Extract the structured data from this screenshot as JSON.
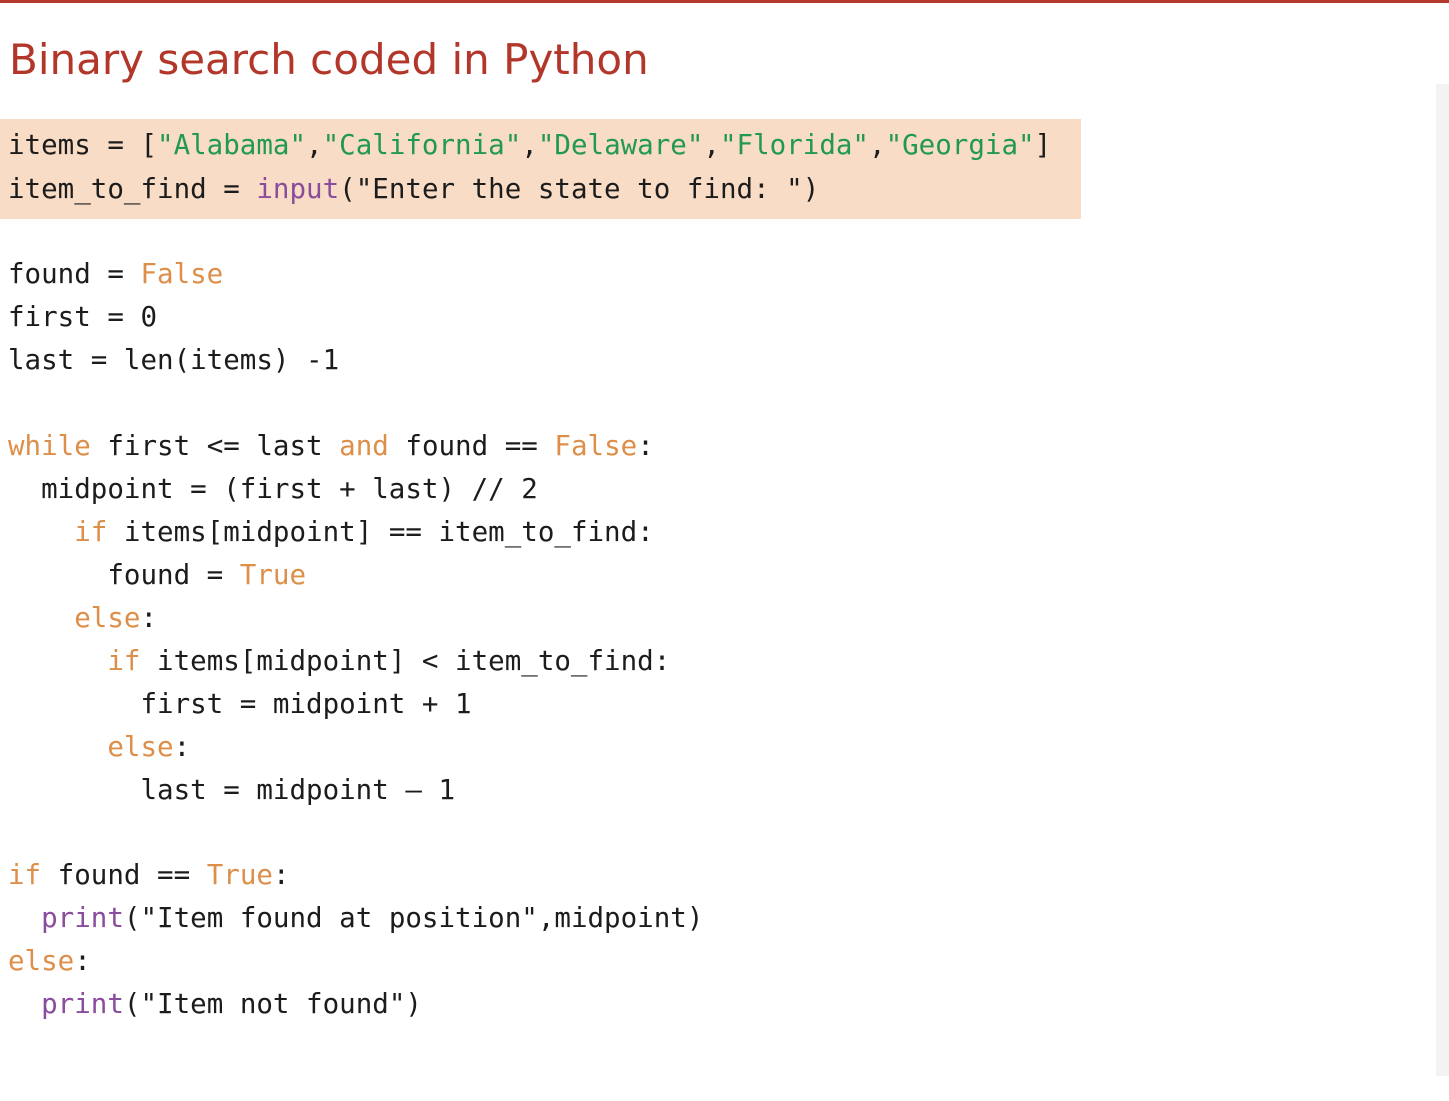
{
  "slide": {
    "title": "Binary search coded in Python"
  },
  "code": {
    "language": "Python",
    "lines": [
      [
        {
          "t": "plain",
          "v": "items = ["
        },
        {
          "t": "str",
          "v": "\"Alabama\""
        },
        {
          "t": "plain",
          "v": ","
        },
        {
          "t": "str",
          "v": "\"California\""
        },
        {
          "t": "plain",
          "v": ","
        },
        {
          "t": "str",
          "v": "\"Delaware\""
        },
        {
          "t": "plain",
          "v": ","
        },
        {
          "t": "str",
          "v": "\"Florida\""
        },
        {
          "t": "plain",
          "v": ","
        },
        {
          "t": "str",
          "v": "\"Georgia\""
        },
        {
          "t": "plain",
          "v": "]"
        }
      ],
      [
        {
          "t": "plain",
          "v": "item_to_find = "
        },
        {
          "t": "fn",
          "v": "input"
        },
        {
          "t": "plain",
          "v": "(\"Enter the state to find: \")"
        }
      ],
      [
        {
          "t": "plain",
          "v": "found = "
        },
        {
          "t": "kw",
          "v": "False"
        }
      ],
      [
        {
          "t": "plain",
          "v": "first = 0"
        }
      ],
      [
        {
          "t": "plain",
          "v": "last = len(items) -1"
        }
      ],
      [
        {
          "t": "kw",
          "v": "while"
        },
        {
          "t": "plain",
          "v": " first <= last "
        },
        {
          "t": "kw",
          "v": "and"
        },
        {
          "t": "plain",
          "v": " found == "
        },
        {
          "t": "kw",
          "v": "False"
        },
        {
          "t": "plain",
          "v": ":"
        }
      ],
      [
        {
          "t": "plain",
          "v": "  midpoint = (first + last) // 2"
        }
      ],
      [
        {
          "t": "plain",
          "v": "    "
        },
        {
          "t": "kw",
          "v": "if"
        },
        {
          "t": "plain",
          "v": " items[midpoint] == item_to_find:"
        }
      ],
      [
        {
          "t": "plain",
          "v": "      found = "
        },
        {
          "t": "kw",
          "v": "True"
        }
      ],
      [
        {
          "t": "plain",
          "v": "    "
        },
        {
          "t": "kw",
          "v": "else"
        },
        {
          "t": "plain",
          "v": ":"
        }
      ],
      [
        {
          "t": "plain",
          "v": "      "
        },
        {
          "t": "kw",
          "v": "if"
        },
        {
          "t": "plain",
          "v": " items[midpoint] < item_to_find:"
        }
      ],
      [
        {
          "t": "plain",
          "v": "        first = midpoint + 1"
        }
      ],
      [
        {
          "t": "plain",
          "v": "      "
        },
        {
          "t": "kw",
          "v": "else"
        },
        {
          "t": "plain",
          "v": ":"
        }
      ],
      [
        {
          "t": "plain",
          "v": "        last = midpoint – 1"
        }
      ],
      [
        {
          "t": "kw",
          "v": "if"
        },
        {
          "t": "plain",
          "v": " found == "
        },
        {
          "t": "kw",
          "v": "True"
        },
        {
          "t": "plain",
          "v": ":"
        }
      ],
      [
        {
          "t": "plain",
          "v": "  "
        },
        {
          "t": "fn",
          "v": "print"
        },
        {
          "t": "plain",
          "v": "(\"Item found at position\",midpoint)"
        }
      ],
      [
        {
          "t": "kw",
          "v": "else"
        },
        {
          "t": "plain",
          "v": ":"
        }
      ],
      [
        {
          "t": "plain",
          "v": "  "
        },
        {
          "t": "fn",
          "v": "print"
        },
        {
          "t": "plain",
          "v": "(\"Item not found\")"
        }
      ]
    ]
  },
  "colors": {
    "title": "#b3362a",
    "keyword": "#dd8f4a",
    "string": "#229a4e",
    "builtin": "#8a4c9c",
    "text": "#1c1c1c",
    "highlight": "#f9dcc6"
  }
}
